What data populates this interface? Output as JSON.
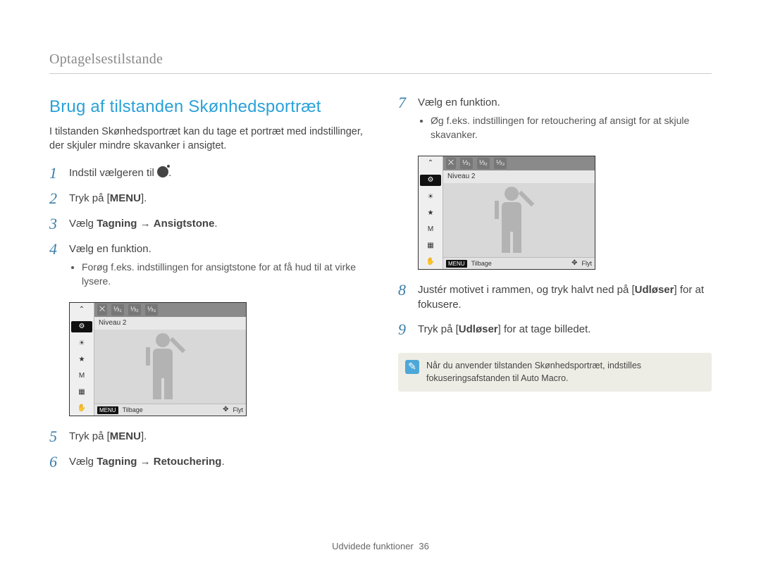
{
  "breadcrumb": "Optagelsestilstande",
  "section_title": "Brug af tilstanden Skønhedsportræt",
  "intro": "I tilstanden Skønhedsportræt kan du tage et portræt med indstillinger, der skjuler mindre skavanker i ansigtet.",
  "steps_left": [
    {
      "num": "1",
      "html_parts": [
        "Indstil vælgeren til ",
        {
          "icon": "mode-beauty"
        },
        "."
      ]
    },
    {
      "num": "2",
      "html_parts": [
        "Tryk på [",
        {
          "bold": "MENU"
        },
        "]."
      ]
    },
    {
      "num": "3",
      "html_parts": [
        "Vælg ",
        {
          "bold": "Tagning"
        },
        " → ",
        {
          "bold": "Ansigtstone"
        },
        "."
      ]
    },
    {
      "num": "4",
      "html_parts": [
        "Vælg en funktion."
      ],
      "sub": [
        "Forøg f.eks. indstillingen for ansigtstone for at få hud til at virke lysere."
      ]
    },
    {
      "num": "5",
      "html_parts": [
        "Tryk på [",
        {
          "bold": "MENU"
        },
        "]."
      ]
    },
    {
      "num": "6",
      "html_parts": [
        "Vælg ",
        {
          "bold": "Tagning"
        },
        " → ",
        {
          "bold": "Retouchering"
        },
        "."
      ]
    }
  ],
  "steps_right": [
    {
      "num": "7",
      "html_parts": [
        "Vælg en funktion."
      ],
      "sub": [
        "Øg f.eks. indstillingen for retouchering af ansigt for at skjule skavanker."
      ]
    },
    {
      "num": "8",
      "html_parts": [
        "Justér motivet i rammen, og tryk halvt ned på [",
        {
          "bold": "Udløser"
        },
        "] for at fokusere."
      ]
    },
    {
      "num": "9",
      "html_parts": [
        "Tryk på [",
        {
          "bold": "Udløser"
        },
        "] for at tage billedet."
      ]
    }
  ],
  "camera_ui": {
    "level_label": "Niveau 2",
    "opt_levels": [
      "⨉",
      "⅓₁",
      "⅓₂",
      "⅓₃"
    ],
    "bottom_menu_tag": "MENU",
    "bottom_back": "Tilbage",
    "bottom_move": "Flyt",
    "side_icons": [
      "⌃",
      "⚙",
      "☀",
      "★",
      "M",
      "▦",
      "✋"
    ]
  },
  "note_text": "Når du anvender tilstanden Skønhedsportræt, indstilles fokuseringsafstanden til Auto Macro.",
  "footer_section": "Udvidede funktioner",
  "footer_page": "36"
}
